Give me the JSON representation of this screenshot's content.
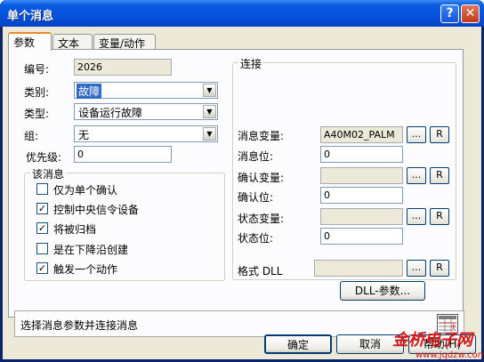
{
  "window": {
    "title": "单个消息",
    "help_btn": "?",
    "close_btn": "✕"
  },
  "tabs": [
    {
      "label": "参数"
    },
    {
      "label": "文本"
    },
    {
      "label": "变量/动作"
    }
  ],
  "left": {
    "number_label": "编号:",
    "number_value": "2026",
    "class_label": "类别:",
    "class_value": "故障",
    "type_label": "类型:",
    "type_value": "设备运行故障",
    "group_label": "组:",
    "group_value": "无",
    "priority_label": "优先级:",
    "priority_value": "0",
    "message_group": "该消息",
    "checks": [
      {
        "label": "仅为单个确认",
        "checked": false
      },
      {
        "label": "控制中央信令设备",
        "checked": true
      },
      {
        "label": "将被归档",
        "checked": true
      },
      {
        "label": "是在下降沿创建",
        "checked": false
      },
      {
        "label": "触发一个动作",
        "checked": true
      }
    ]
  },
  "right": {
    "group_title": "连接",
    "msg_var_label": "消息变量:",
    "msg_var_value": "A40M02_PALM",
    "msg_bit_label": "消息位:",
    "msg_bit_value": "0",
    "ack_var_label": "确认变量:",
    "ack_var_value": "",
    "ack_bit_label": "确认位:",
    "ack_bit_value": "0",
    "status_var_label": "状态变量:",
    "status_var_value": "",
    "status_bit_label": "状态位:",
    "status_bit_value": "0",
    "format_dll_label": "格式 DLL",
    "format_dll_value": "",
    "browse": "...",
    "remove": "R",
    "dll_params_button": "DLL-参数..."
  },
  "status_text": "选择消息参数并连接消息",
  "buttons": {
    "ok": "确定",
    "cancel": "取消",
    "help": "帮助(H)"
  },
  "watermark": {
    "line1": "金桥电子网",
    "line2": "www.jqdzw.com"
  }
}
